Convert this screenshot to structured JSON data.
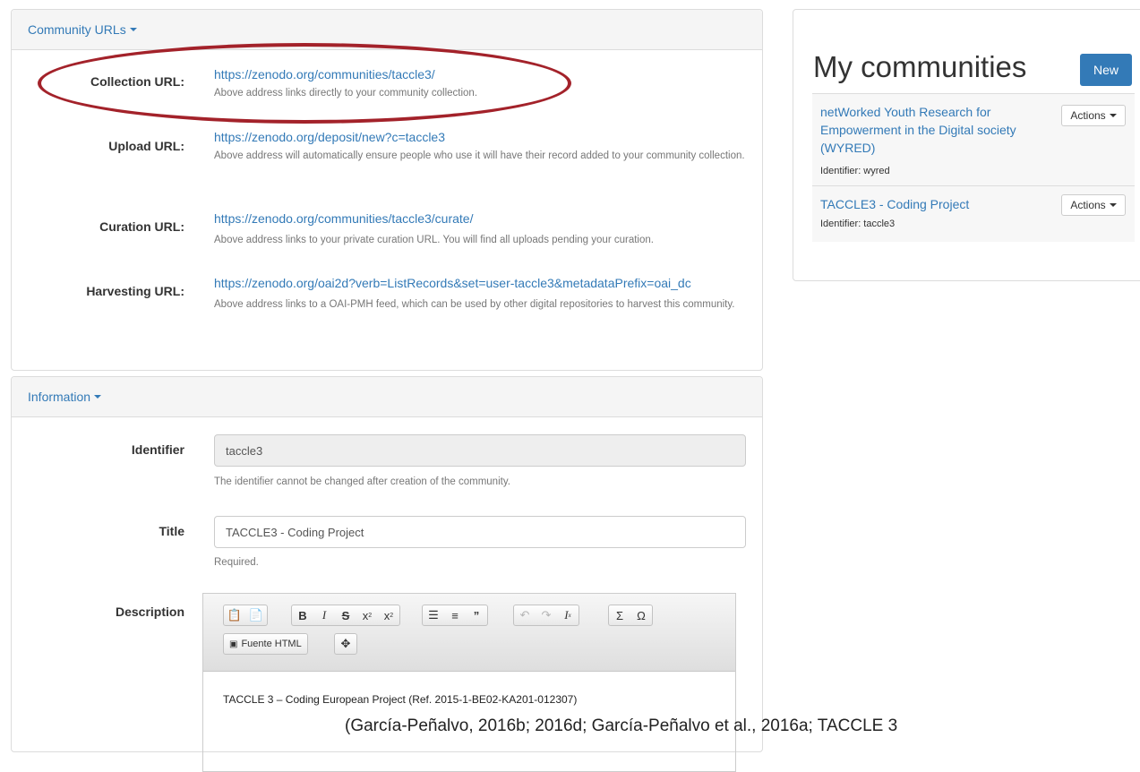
{
  "community_urls": {
    "header": "Community URLs",
    "rows": [
      {
        "label": "Collection URL:",
        "url": "https://zenodo.org/communities/taccle3/",
        "help": "Above address links directly to your community collection."
      },
      {
        "label": "Upload URL:",
        "url": "https://zenodo.org/deposit/new?c=taccle3",
        "help": "Above address will automatically ensure people who use it will have their record added to your community collection."
      },
      {
        "label": "Curation URL:",
        "url": "https://zenodo.org/communities/taccle3/curate/",
        "help": "Above address links to your private curation URL. You will find all uploads pending your curation."
      },
      {
        "label": "Harvesting URL:",
        "url": "https://zenodo.org/oai2d?verb=ListRecords&set=user-taccle3&metadataPrefix=oai_dc",
        "help": "Above address links to a OAI-PMH feed, which can be used by other digital repositories to harvest this community."
      }
    ]
  },
  "information": {
    "header": "Information",
    "identifier": {
      "label": "Identifier",
      "value": "taccle3",
      "help": "The identifier cannot be changed after creation of the community."
    },
    "title": {
      "label": "Title",
      "value": "TACCLE3 - Coding Project",
      "help": "Required."
    },
    "description": {
      "label": "Description",
      "source_label": "Fuente HTML",
      "content": "TACCLE 3 – Coding European Project (Ref. 2015-1-BE02-KA201-012307)"
    }
  },
  "my_communities": {
    "title": "My communities",
    "new_label": "New",
    "items": [
      {
        "name": "netWorked Youth Research for Empowerment in the Digital society (WYRED)",
        "identifier": "Identifier: wyred",
        "actions_label": "Actions"
      },
      {
        "name": "TACCLE3 - Coding Project",
        "identifier": "Identifier: taccle3",
        "actions_label": "Actions"
      }
    ]
  },
  "caption": "(García-Peñalvo, 2016b; 2016d; García-Peñalvo et al., 2016a; TACCLE 3",
  "colors": {
    "link": "#337ab7",
    "primary_button": "#337ab7",
    "highlight_oval": "#a3222a"
  }
}
